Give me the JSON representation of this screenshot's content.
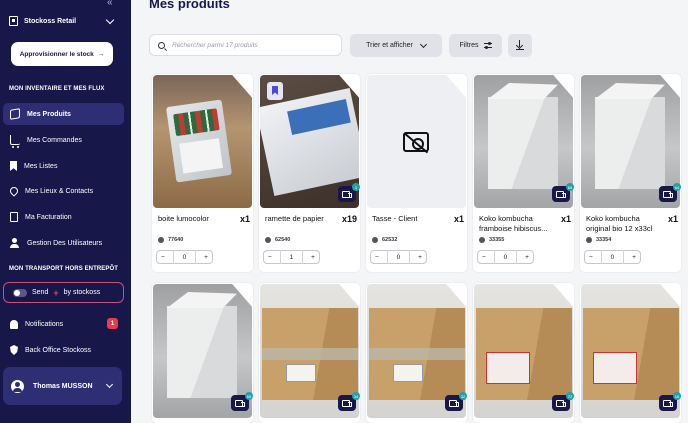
{
  "sidebar": {
    "brand": "Stockoss Retail",
    "restock_label": "Approvisionner le stock",
    "inventory_section": "MON INVENTAIRE ET MES FLUX",
    "items": [
      {
        "label": "Mes Produits",
        "icon": "box-icon",
        "active": true
      },
      {
        "label": "Mes Commandes",
        "icon": "cart-icon"
      },
      {
        "label": "Mes Listes",
        "icon": "bookmark-icon"
      },
      {
        "label": "Mes Lieux & Contacts",
        "icon": "map-pin-icon"
      },
      {
        "label": "Ma Facturation",
        "icon": "document-icon"
      },
      {
        "label": "Gestion Des Utilisateurs",
        "icon": "users-icon"
      }
    ],
    "transport_section": "MON TRANSPORT HORS ENTREPÔT",
    "send_label_a": "Send",
    "send_label_b": "by stockoss",
    "notifications_label": "Notifications",
    "notifications_count": "1",
    "backoffice_label": "Back Office Stockoss",
    "user_name": "Thomas MUSSON"
  },
  "main": {
    "title": "Mes produits",
    "search_placeholder": "Rechercher parmi 17 produits",
    "sort_label": "Trier et afficher",
    "filter_label": "Filtres"
  },
  "products": [
    {
      "name": "boite lumocolor",
      "qty": "x1",
      "ref": "77640",
      "count": "0",
      "image": "lumocolor"
    },
    {
      "name": "ramette de papier",
      "qty": "x19",
      "ref": "62540",
      "count": "1",
      "image": "paper",
      "truck_badge": "1"
    },
    {
      "name": "Tasse - Client",
      "qty": "x1",
      "ref": "62532",
      "count": "0",
      "image": "none"
    },
    {
      "name": "Koko kombucha framboise hibiscus...",
      "qty": "x1",
      "ref": "33355",
      "count": "0",
      "image": "box",
      "truck_badge": "65"
    },
    {
      "name": "Koko kombucha original bio 12 x33cl",
      "qty": "x1",
      "ref": "33354",
      "count": "0",
      "image": "box",
      "truck_badge": "64"
    }
  ],
  "products_row2": [
    {
      "image": "box",
      "truck_badge": "65"
    },
    {
      "image": "carton",
      "truck_badge": "34"
    },
    {
      "image": "carton",
      "truck_badge": "32"
    },
    {
      "image": "carton-red",
      "truck_badge": "72"
    },
    {
      "image": "carton-red",
      "truck_badge": "16"
    }
  ]
}
